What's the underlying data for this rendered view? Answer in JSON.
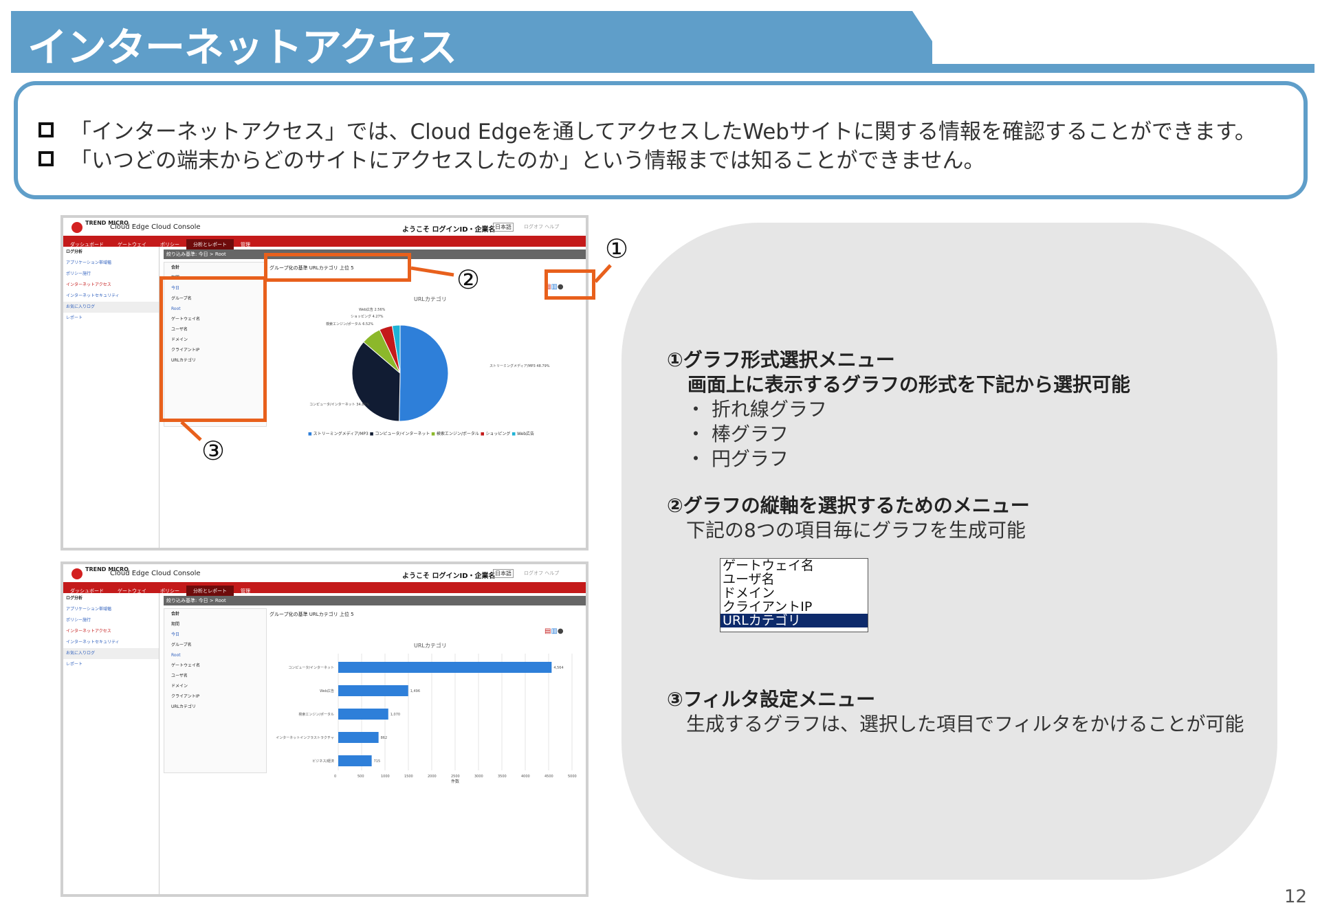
{
  "title": "インターネットアクセス",
  "intro": {
    "line1": "「インターネットアクセス」では、Cloud Edgeを通してアクセスしたWebサイトに関する情報を確認することができます。",
    "line2": "「いつどの端末からどのサイトにアクセスしたのか」という情報までは知ることができません。"
  },
  "screens": {
    "brand": "TREND MICRO",
    "console": "Cloud Edge Cloud Console",
    "welcome": "ようこそ ログインID・企業名",
    "lang": "日本語",
    "links": "ログオフ  ヘルプ",
    "nav": [
      "ダッシュボード",
      "ゲートウェイ",
      "ポリシー",
      "分析とレポート",
      "管理"
    ],
    "side": [
      "ログ分析",
      "アプリケーション帯域幅",
      "ポリシー施行",
      "インターネットアクセス",
      "インターネットセキュリティ",
      "お気に入りログ",
      "レポート"
    ],
    "crumb": "絞り込み基準: 今日 > Root",
    "filters": [
      "合計",
      "期間",
      "今日",
      "グループ名",
      "Root",
      "ゲートウェイ名",
      "ユーザ名",
      "ドメイン",
      "クライアントIP",
      "URLカテゴリ"
    ],
    "ctl": "グループ化の基準 URLカテゴリ  上位 5",
    "chart_title": "URLカテゴリ",
    "pie_labels": [
      "Web広告 2.56%",
      "ショッピング 4.27%",
      "検索エンジン/ポータル 6.52%",
      "コンピュータ/インターネット 34.85%",
      "ストリーミングメディア/MP3 48.79%"
    ],
    "legend": [
      "ストリーミングメディア/MP3",
      "コンピュータ/インターネット",
      "検索エンジン/ポータル",
      "ショッピング",
      "Web広告"
    ],
    "bar_categories": [
      "コンピュータ/インターネット",
      "Web広告",
      "検索エンジン/ポータル",
      "インターネットインフラストラクチャ",
      "ビジネス/経済"
    ],
    "bar_value_labels": [
      "4,564",
      "1,496",
      "1,070",
      "862",
      "715"
    ],
    "bar_axis_label": "件数"
  },
  "chart_data": [
    {
      "type": "pie",
      "title": "URLカテゴリ",
      "categories": [
        "ストリーミングメディア/MP3",
        "コンピュータ/インターネット",
        "検索エンジン/ポータル",
        "ショッピング",
        "Web広告"
      ],
      "values": [
        48.79,
        34.85,
        6.52,
        4.27,
        2.56
      ],
      "colors": [
        "#2e7fd9",
        "#111c33",
        "#8cb82a",
        "#c41a1a",
        "#1fb3d6"
      ]
    },
    {
      "type": "bar",
      "title": "URLカテゴリ",
      "categories": [
        "コンピュータ/インターネット",
        "Web広告",
        "検索エンジン/ポータル",
        "インターネットインフラストラクチャ",
        "ビジネス/経済"
      ],
      "values": [
        4564,
        1496,
        1070,
        862,
        715
      ],
      "xlabel": "件数",
      "xlim": [
        0,
        5000
      ]
    }
  ],
  "callouts": {
    "c1": "①",
    "c2": "②",
    "c3": "③"
  },
  "info": {
    "h1": "①グラフ形式選択メニュー",
    "s1": "画面上に表示するグラフの形式を下記から選択可能",
    "opts": [
      "・ 折れ線グラフ",
      "・ 棒グラフ",
      "・ 円グラフ"
    ],
    "h2": "②グラフの縦軸を選択するためのメニュー",
    "s2": "下記の8つの項目毎にグラフを生成可能",
    "dropdown": [
      "ゲートウェイ名",
      "ユーザ名",
      "ドメイン",
      "クライアントIP",
      "URLカテゴリ"
    ],
    "h3": "③フィルタ設定メニュー",
    "s3": "生成するグラフは、選択した項目でフィルタをかけることが可能"
  },
  "page_number": "12"
}
